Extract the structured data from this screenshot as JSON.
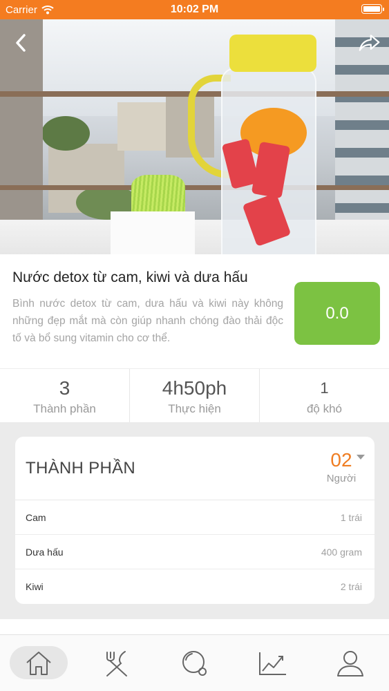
{
  "status_bar": {
    "carrier": "Carrier",
    "time": "10:02 PM",
    "bar_color": "#f47c20"
  },
  "hero": {
    "back_icon": "chevron-left-icon",
    "share_icon": "share-arrow-icon"
  },
  "recipe": {
    "title": "Nước detox từ cam, kiwi và dưa hấu",
    "description": "Bình nước detox từ cam, dưa hấu và kiwi này không những đẹp mắt mà còn giúp nhanh chóng đào thải độc tố và bổ sung vitamin cho cơ thể.",
    "rating": "0.0",
    "rating_color": "#7cc242"
  },
  "stats": [
    {
      "value": "3",
      "label": "Thành phần"
    },
    {
      "value": "4h50ph",
      "label": "Thực hiện"
    },
    {
      "value": "1",
      "label": "độ khó"
    }
  ],
  "ingredients": {
    "title": "THÀNH PHẦN",
    "servings_count": "02",
    "servings_label": "Người",
    "accent_color": "#ef7d22",
    "items": [
      {
        "name": "Cam",
        "quantity": "1 trái"
      },
      {
        "name": "Dưa hấu",
        "quantity": "400 gram"
      },
      {
        "name": "Kiwi",
        "quantity": "2 trái"
      }
    ]
  },
  "bottom_nav": {
    "items": [
      {
        "icon": "home-icon",
        "active": true
      },
      {
        "icon": "utensils-icon",
        "active": false
      },
      {
        "icon": "search-icon",
        "active": false
      },
      {
        "icon": "trending-chart-icon",
        "active": false
      },
      {
        "icon": "user-icon",
        "active": false
      }
    ]
  }
}
